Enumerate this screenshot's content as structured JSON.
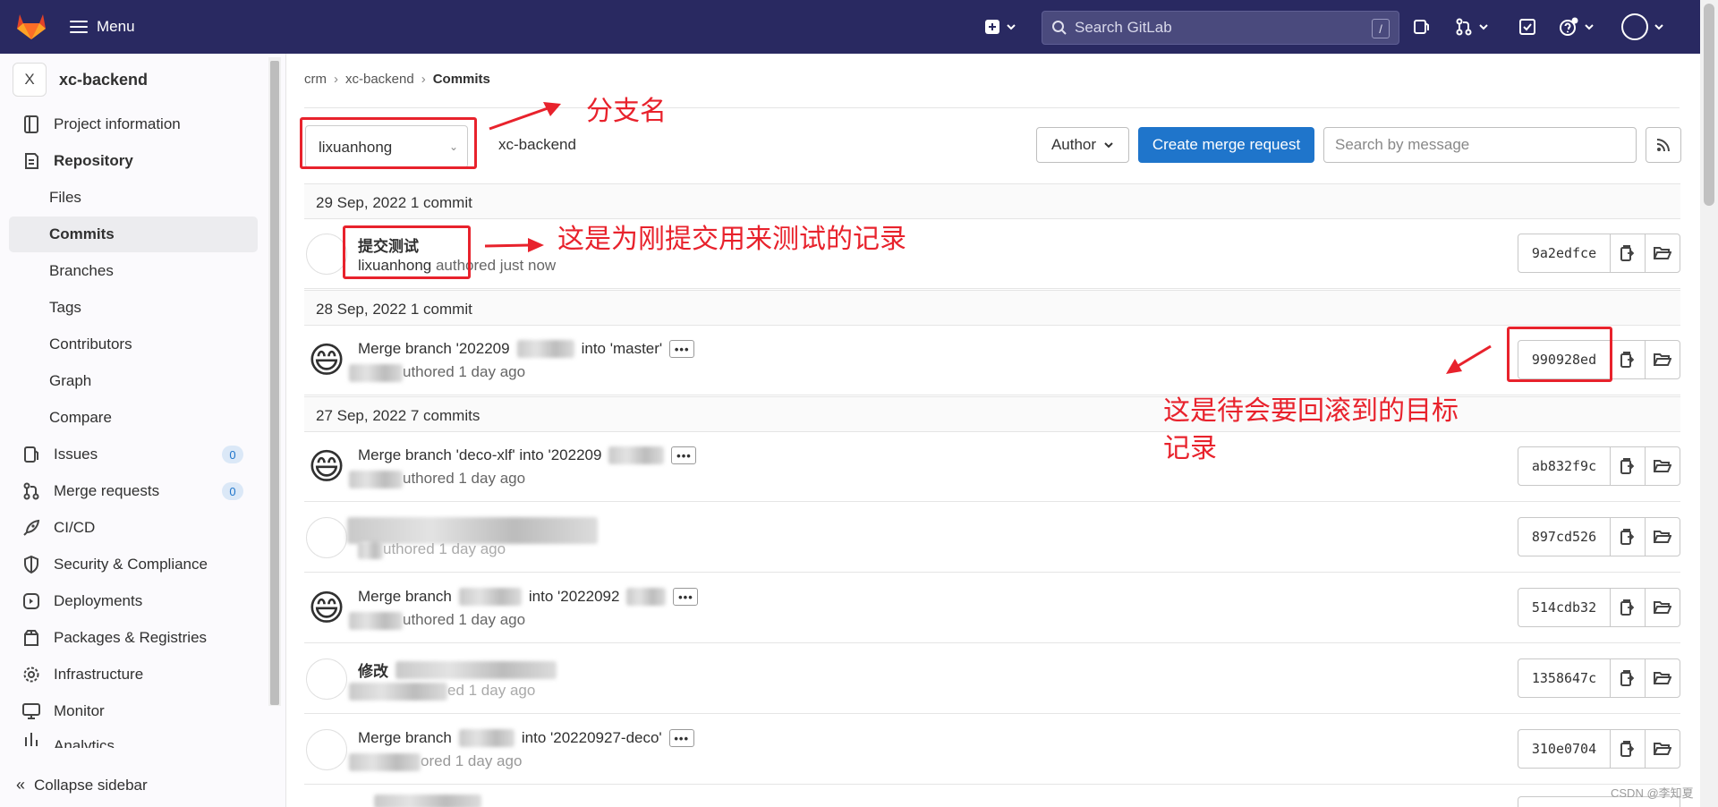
{
  "topbar": {
    "menu_label": "Menu",
    "search_placeholder": "Search GitLab",
    "search_shortcut": "/"
  },
  "sidebar": {
    "project_initial": "X",
    "project_name": "xc-backend",
    "items": [
      {
        "label": "Project information"
      },
      {
        "label": "Repository"
      },
      {
        "label": "Files"
      },
      {
        "label": "Commits"
      },
      {
        "label": "Branches"
      },
      {
        "label": "Tags"
      },
      {
        "label": "Contributors"
      },
      {
        "label": "Graph"
      },
      {
        "label": "Compare"
      },
      {
        "label": "Issues",
        "count": "0"
      },
      {
        "label": "Merge requests",
        "count": "0"
      },
      {
        "label": "CI/CD"
      },
      {
        "label": "Security & Compliance"
      },
      {
        "label": "Deployments"
      },
      {
        "label": "Packages & Registries"
      },
      {
        "label": "Infrastructure"
      },
      {
        "label": "Monitor"
      },
      {
        "label": "Analytics"
      }
    ],
    "collapse_label": "Collapse sidebar"
  },
  "breadcrumb": [
    "crm",
    "xc-backend",
    "Commits"
  ],
  "toolbar": {
    "branch": "lixuanhong",
    "path": "xc-backend",
    "author_label": "Author",
    "create_mr_label": "Create merge request",
    "search_placeholder": "Search by message"
  },
  "days": [
    {
      "header": "29 Sep, 2022 1 commit"
    },
    {
      "header": "28 Sep, 2022 1 commit"
    },
    {
      "header": "27 Sep, 2022 7 commits"
    }
  ],
  "commits": [
    {
      "title": "提交测试",
      "author": "lixuanhong",
      "meta": " authored just now",
      "sha": "9a2edfce"
    },
    {
      "title_a": "Merge branch '202209",
      "title_b": "into 'master'",
      "meta": "uthored 1 day ago",
      "sha": "990928ed"
    },
    {
      "title_a": "Merge branch 'deco-xlf' into '202209",
      "meta": "uthored 1 day ago",
      "sha": "ab832f9c"
    },
    {
      "meta": "uthored 1 day ago",
      "sha": "897cd526"
    },
    {
      "title_a": "Merge branch",
      "title_b": "into '2022092",
      "meta": "uthored 1 day ago",
      "sha": "514cdb32"
    },
    {
      "title_a": "修改",
      "meta": "ed 1 day ago",
      "sha": "1358647c"
    },
    {
      "title_a": "Merge branch",
      "title_b": "into '20220927-deco'",
      "meta": "ored 1 day ago",
      "sha": "310e0704"
    }
  ],
  "annotations": {
    "branch_note": "分支名",
    "test_note": "这是为刚提交用来测试的记录",
    "target_note_line1": "这是待会要回滚到的目标",
    "target_note_line2": "记录",
    "color": "#e8222c"
  },
  "watermark": "CSDN @李知夏"
}
